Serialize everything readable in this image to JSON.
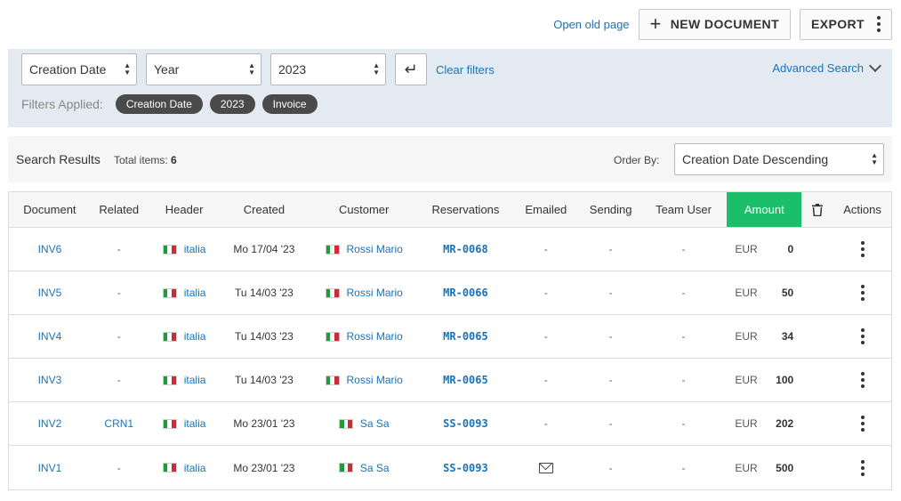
{
  "topbar": {
    "open_old_page": "Open old page",
    "new_document": "NEW DOCUMENT",
    "export": "EXPORT"
  },
  "filters": {
    "field_select": "Creation Date",
    "period_select": "Year",
    "value_select": "2023",
    "clear_filters": "Clear filters",
    "advanced_search": "Advanced Search",
    "applied_label": "Filters Applied:",
    "chips": [
      "Creation Date",
      "2023",
      "Invoice"
    ]
  },
  "results": {
    "title": "Search Results",
    "total_label": "Total items:",
    "total_value": "6",
    "order_label": "Order By:",
    "order_value": "Creation Date Descending"
  },
  "table": {
    "headers": {
      "document": "Document",
      "related": "Related",
      "header": "Header",
      "created": "Created",
      "customer": "Customer",
      "reservations": "Reservations",
      "emailed": "Emailed",
      "sending": "Sending",
      "team_user": "Team User",
      "amount": "Amount",
      "actions": "Actions"
    },
    "rows": [
      {
        "document": "INV6",
        "related": "-",
        "header": "italia",
        "created": "Mo 17/04 '23",
        "customer": "Rossi Mario",
        "reservation": "MR-0068",
        "emailed": "-",
        "sending": "-",
        "team_user": "-",
        "currency": "EUR",
        "amount": "0"
      },
      {
        "document": "INV5",
        "related": "-",
        "header": "italia",
        "created": "Tu 14/03 '23",
        "customer": "Rossi Mario",
        "reservation": "MR-0066",
        "emailed": "-",
        "sending": "-",
        "team_user": "-",
        "currency": "EUR",
        "amount": "50"
      },
      {
        "document": "INV4",
        "related": "-",
        "header": "italia",
        "created": "Tu 14/03 '23",
        "customer": "Rossi Mario",
        "reservation": "MR-0065",
        "emailed": "-",
        "sending": "-",
        "team_user": "-",
        "currency": "EUR",
        "amount": "34"
      },
      {
        "document": "INV3",
        "related": "-",
        "header": "italia",
        "created": "Tu 14/03 '23",
        "customer": "Rossi Mario",
        "reservation": "MR-0065",
        "emailed": "-",
        "sending": "-",
        "team_user": "-",
        "currency": "EUR",
        "amount": "100"
      },
      {
        "document": "INV2",
        "related": "CRN1",
        "header": "italia",
        "created": "Mo 23/01 '23",
        "customer": "Sa Sa",
        "reservation": "SS-0093",
        "emailed": "-",
        "sending": "-",
        "team_user": "-",
        "currency": "EUR",
        "amount": "202"
      },
      {
        "document": "INV1",
        "related": "-",
        "header": "italia",
        "created": "Mo 23/01 '23",
        "customer": "Sa Sa",
        "reservation": "SS-0093",
        "emailed": "",
        "sending": "-",
        "team_user": "-",
        "currency": "EUR",
        "amount": "500"
      }
    ],
    "emailed_icon": "mail-icon",
    "colors": {
      "amount_header": "#1bbf69",
      "link": "#1a73b8"
    }
  }
}
